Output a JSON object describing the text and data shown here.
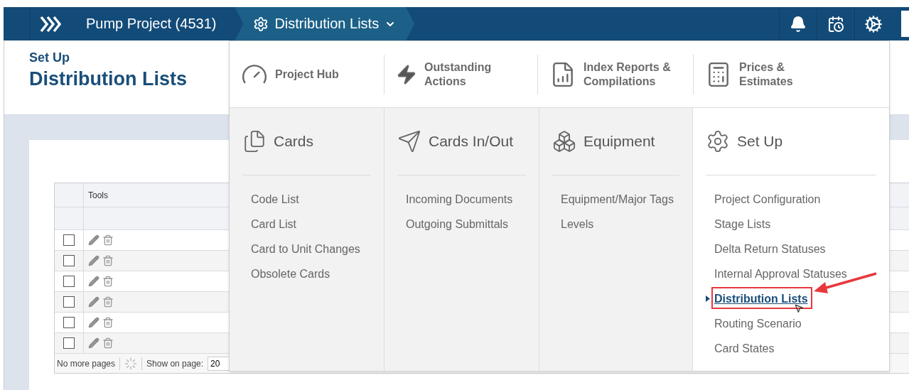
{
  "nav": {
    "crumbs": [
      {
        "label": "Pump Project (4531)",
        "selected": false
      },
      {
        "label": "Distribution Lists",
        "selected": true
      }
    ]
  },
  "header": {
    "subtitle": "Set Up",
    "title": "Distribution Lists"
  },
  "table": {
    "columns": [
      "Tools"
    ],
    "rows": [
      {
        "checked": false
      },
      {
        "checked": false
      },
      {
        "checked": false
      },
      {
        "checked": false
      },
      {
        "checked": false
      },
      {
        "checked": false
      }
    ],
    "footer": {
      "status": "No more pages",
      "page_size_label": "Show on page:",
      "page_size": "20"
    }
  },
  "menu": {
    "top_items": [
      {
        "label": "Project Hub"
      },
      {
        "label": "Outstanding Actions"
      },
      {
        "label": "Index Reports & Compilations"
      },
      {
        "label": "Prices & Estimates"
      }
    ],
    "sections": [
      {
        "title": "Cards",
        "selected": false,
        "items": [
          {
            "label": "Code List",
            "selected": false
          },
          {
            "label": "Card List",
            "selected": false
          },
          {
            "label": "Card to Unit Changes",
            "selected": false
          },
          {
            "label": "Obsolete Cards",
            "selected": false
          }
        ]
      },
      {
        "title": "Cards In/Out",
        "selected": false,
        "items": [
          {
            "label": "Incoming Documents",
            "selected": false
          },
          {
            "label": "Outgoing Submittals",
            "selected": false
          }
        ]
      },
      {
        "title": "Equipment",
        "selected": false,
        "items": [
          {
            "label": "Equipment/Major Tags",
            "selected": false
          },
          {
            "label": "Levels",
            "selected": false
          }
        ]
      },
      {
        "title": "Set Up",
        "selected": true,
        "items": [
          {
            "label": "Project Configuration",
            "selected": false
          },
          {
            "label": "Stage Lists",
            "selected": false
          },
          {
            "label": "Delta Return Statuses",
            "selected": false
          },
          {
            "label": "Internal Approval Statuses",
            "selected": false
          },
          {
            "label": "Distribution Lists",
            "selected": true,
            "annotated": true
          },
          {
            "label": "Routing Scenario",
            "selected": false
          },
          {
            "label": "Card States",
            "selected": false
          }
        ]
      }
    ]
  }
}
